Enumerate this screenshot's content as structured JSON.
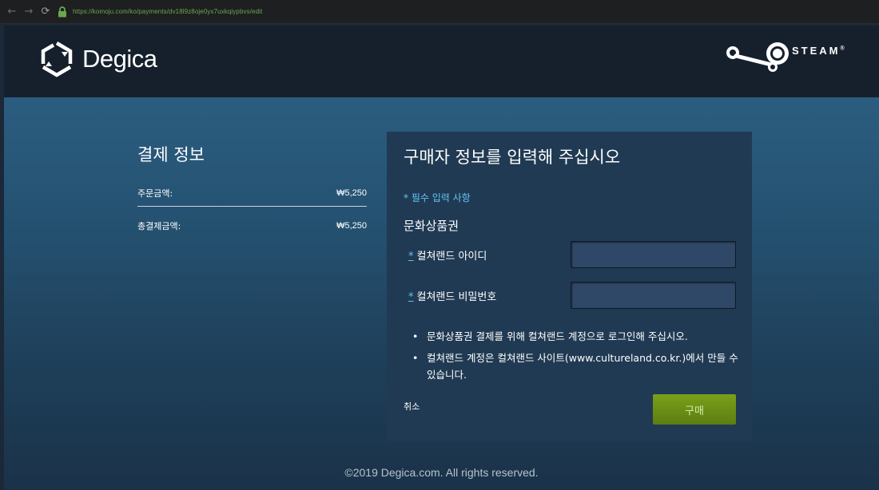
{
  "browser": {
    "url": "https://komoju.com/ko/payments/dv18l9z8oje0yx7uxkqiypbvs/edit",
    "back_icon": "arrow-left-icon",
    "forward_icon": "arrow-right-icon",
    "reload_icon": "reload-icon",
    "lock_icon": "lock-icon",
    "lock_color": "#6aa84f"
  },
  "header": {
    "logo_text": "Degica",
    "steam_text": "STEAM",
    "steam_mark": "®"
  },
  "summary": {
    "title": "결제 정보",
    "rows": [
      {
        "label": "주문금액:",
        "value": "₩5,250"
      },
      {
        "label": "총결제금액:",
        "value": "₩5,250"
      }
    ]
  },
  "form": {
    "title": "구매자 정보를 입력해 주십시오",
    "required_note": "* 필수 입력 사항",
    "section_title": "문화상품권",
    "fields": [
      {
        "required_mark": "*",
        "label": "컬쳐랜드 아이디",
        "value": "",
        "placeholder": ""
      },
      {
        "required_mark": "*",
        "label": "컬쳐랜드 비밀번호",
        "value": "",
        "placeholder": ""
      }
    ],
    "notes": [
      "문화상품권 결제를 위해 컬쳐랜드 계정으로 로그인해 주십시오.",
      "컬쳐랜드 계정은 컬쳐랜드 사이트(www.cultureland.co.kr.)에서 만들 수 있습니다."
    ],
    "cancel_label": "취소",
    "buy_label": "구매"
  },
  "footer": {
    "copyright": "©2019 Degica.com. All rights reserved."
  },
  "colors": {
    "accent_blue": "#66c0f4",
    "buy_green": "#6b8f14",
    "panel_bg": "#203a53",
    "header_bg": "#16202d"
  }
}
